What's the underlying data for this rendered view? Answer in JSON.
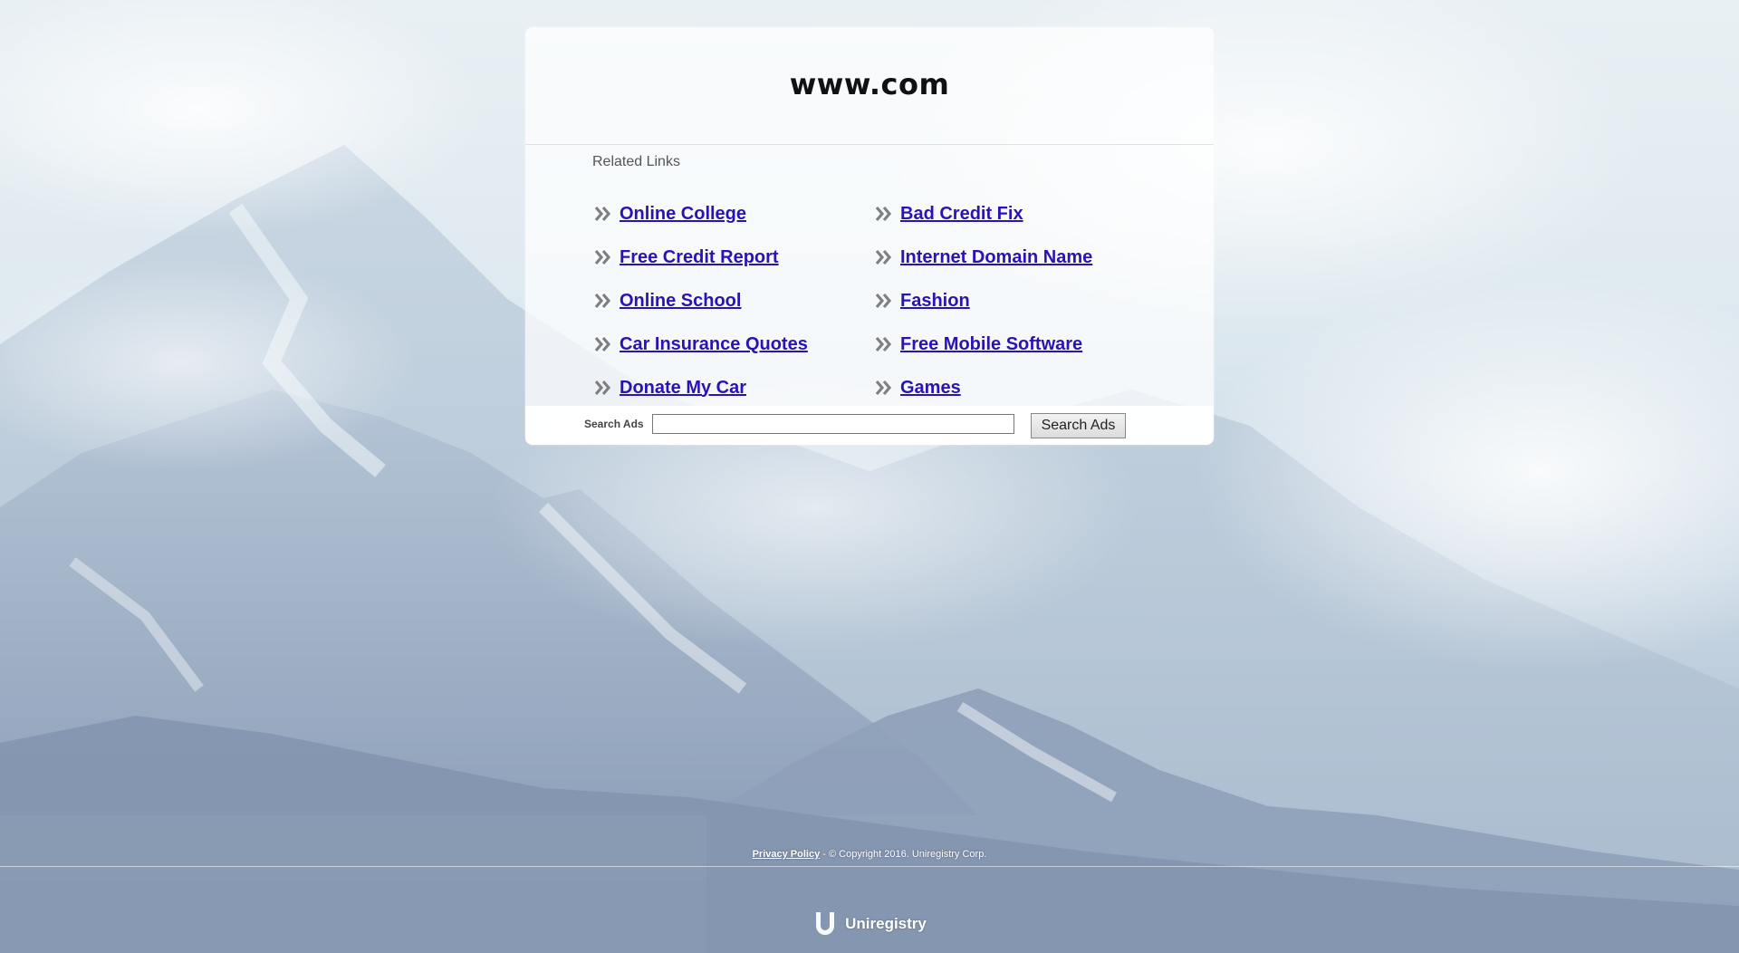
{
  "page": {
    "domain_title": "www.com"
  },
  "related_links": {
    "label": "Related Links",
    "left_column": [
      "Online College",
      "Free Credit Report",
      "Online School",
      "Car Insurance Quotes",
      "Donate My Car"
    ],
    "right_column": [
      "Bad Credit Fix",
      "Internet Domain Name",
      "Fashion",
      "Free Mobile Software",
      "Games"
    ]
  },
  "search": {
    "label": "Search Ads",
    "input_value": "",
    "input_placeholder": "",
    "button_label": "Search Ads"
  },
  "footer": {
    "privacy_label": "Privacy Policy",
    "copyright": " - © Copyright 2016. Uniregistry Corp.",
    "brand_name": "Uniregistry"
  },
  "colors": {
    "link": "#2b12b5",
    "arrow": "#808080",
    "sky": "#e9f0f4",
    "mountain_shadow": "#8c9db6"
  },
  "icons": {
    "link_bullet": "double-chevron-right-icon",
    "brand_logo": "uniregistry-u-logo"
  }
}
